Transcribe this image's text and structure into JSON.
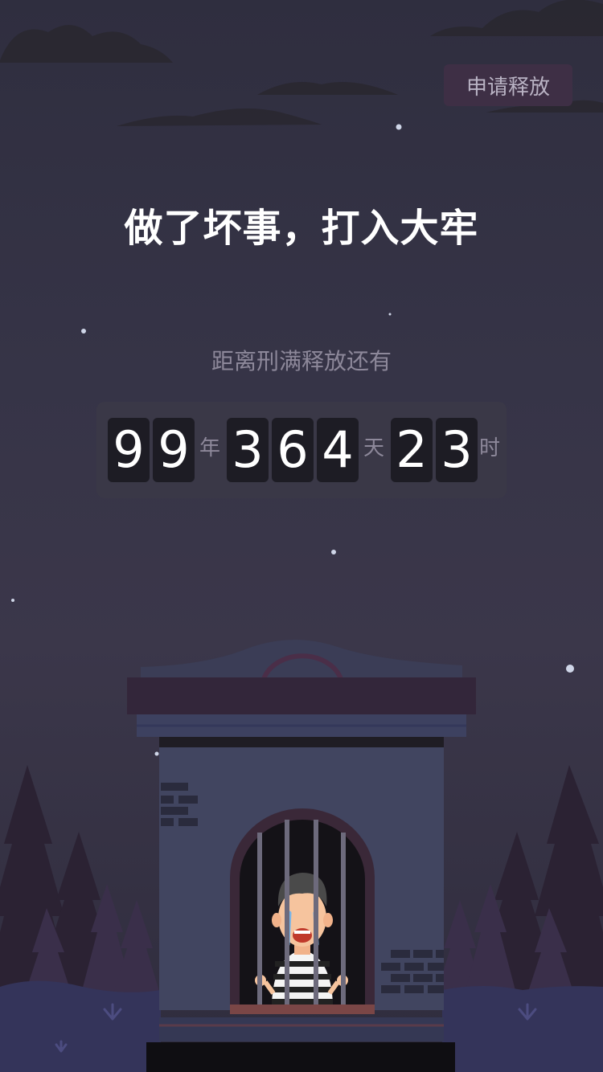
{
  "header": {
    "release_button": "申请释放"
  },
  "main": {
    "headline": "做了坏事，打入大牢",
    "subtitle": "距离刑满释放还有",
    "countdown": {
      "years": [
        "9",
        "9"
      ],
      "year_unit": "年",
      "days": [
        "3",
        "6",
        "4"
      ],
      "day_unit": "天",
      "hours": [
        "2",
        "3"
      ],
      "hour_unit": "时"
    }
  },
  "colors": {
    "background": "#363447",
    "button_bg": "#3e2f45",
    "digit_bg": "#1d1c24",
    "countdown_bg": "#3a3847"
  },
  "icons": [
    "prison-illustration",
    "prisoner-illustration",
    "pine-tree-icon",
    "cloud-icon",
    "star-icon"
  ]
}
